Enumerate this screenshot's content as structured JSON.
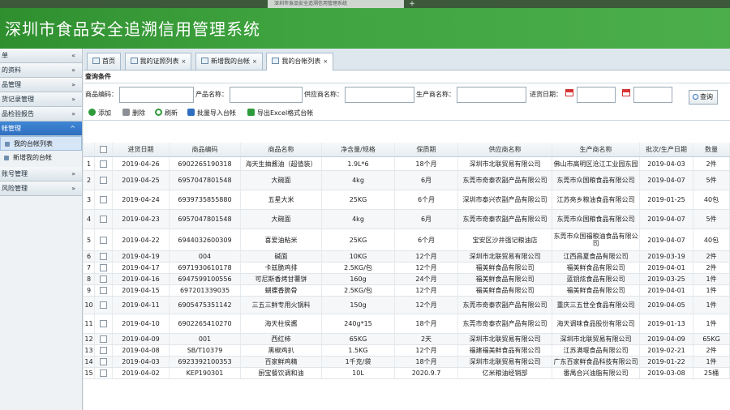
{
  "browser": {
    "tab_title": "深圳市食品安全追溯信用管理系统",
    "new_tab": "+"
  },
  "header": {
    "title": "深圳市食品安全追溯信用管理系统"
  },
  "sidebar": {
    "items": [
      {
        "label": "单",
        "chev": "«"
      },
      {
        "label": "的资料",
        "chev": "»"
      },
      {
        "label": "品管理",
        "chev": "»"
      },
      {
        "label": "货记录管理",
        "chev": "»"
      },
      {
        "label": "品检验报告",
        "chev": "»"
      },
      {
        "label": "帐管理",
        "chev": "^"
      }
    ],
    "sub": [
      {
        "label": "我的台帐列表"
      },
      {
        "label": "新增我的台帐"
      }
    ],
    "items2": [
      {
        "label": "账号管理",
        "chev": "»"
      },
      {
        "label": "风险管理",
        "chev": "»"
      }
    ]
  },
  "tabs": [
    {
      "label": "首页",
      "close": ""
    },
    {
      "label": "我的证照列表",
      "close": "×"
    },
    {
      "label": "新增我的台帐",
      "close": "×"
    },
    {
      "label": "我的台帐列表",
      "close": "×"
    }
  ],
  "query": {
    "title": "查询条件",
    "product_code": "商品编码：",
    "product_name": "产品名称：",
    "supplier": "供应商名称：",
    "producer": "生产商名称：",
    "date": "进货日期：",
    "search_btn": "查询"
  },
  "toolbar": {
    "add": "添加",
    "delete": "删除",
    "refresh": "刷新",
    "import": "批量导入台帐",
    "export": "导出Excel格式台帐"
  },
  "table": {
    "columns": [
      "进货日期",
      "商品编码",
      "商品名称",
      "净含量/规格",
      "保质期",
      "供应商名称",
      "生产商名称",
      "批次/生产日期",
      "数量"
    ],
    "rows": [
      [
        "2019-04-26",
        "6902265190318",
        "海天生抽酱油（超值装）",
        "1.9L*6",
        "18个月",
        "深圳市北联贸易有限公司",
        "佛山市高明区沧江工业园东园",
        "2019-04-03",
        "2件"
      ],
      [
        "2019-04-25",
        "6957047801548",
        "大碗面",
        "4kg",
        "6月",
        "东莞市奇泰农副产品有限公司",
        "东莞市众国粮食品有限公司",
        "2019-04-07",
        "5件"
      ],
      [
        "2019-04-24",
        "6939735855880",
        "五星大米",
        "25KG",
        "6个月",
        "深圳市泰兴农副产品有限公司",
        "江苏亮乡粮油食品有限公司",
        "2019-01-25",
        "40包"
      ],
      [
        "2019-04-23",
        "6957047801548",
        "大碗面",
        "4kg",
        "6月",
        "东莞市奇泰农副产品有限公司",
        "东莞市众国粮食品有限公司",
        "2019-04-07",
        "5件"
      ],
      [
        "2019-04-22",
        "6944032600309",
        "喜爱油粘米",
        "25KG",
        "6个月",
        "宝安区沙井强记粮油店",
        "东莞市众国福粮油食品有限公司",
        "2019-04-07",
        "40包"
      ],
      [
        "2019-04-19",
        "004",
        "碱面",
        "10KG",
        "12个月",
        "深圳市北联贸易有限公司",
        "江西昌夏食品有限公司",
        "2019-03-19",
        "2件"
      ],
      [
        "2019-04-17",
        "6971930610178",
        "卡兹脆鸡排",
        "2.5KG/包",
        "12个月",
        "福美鲜食品有限公司",
        "福美鲜食品有限公司",
        "2019-04-01",
        "2件"
      ],
      [
        "2019-04-16",
        "6947599100556",
        "可尼斯香烤甘薯饼",
        "160g",
        "24个月",
        "福美鲜食品有限公司",
        "蓝钥炫食品有限公司",
        "2019-03-25",
        "1件"
      ],
      [
        "2019-04-15",
        "697201339035",
        "蝴蝶香脆骨",
        "2.5KG/包",
        "12个月",
        "福美鲜食品有限公司",
        "福美鲜食品有限公司",
        "2019-04-01",
        "1件"
      ],
      [
        "2019-04-11",
        "6905475351142",
        "三五三鲜专用火锅料",
        "150g",
        "12个月",
        "东莞市奇泰农副产品有限公司",
        "重庆三五世全食品有限公司",
        "2019-04-05",
        "1件"
      ],
      [
        "2019-04-10",
        "6902265410270",
        "海天柱侯酱",
        "240g*15",
        "18个月",
        "东莞市奇泰农副产品有限公司",
        "海天调味食品股份有限公司",
        "2019-01-13",
        "1件"
      ],
      [
        "2019-04-09",
        "001",
        "西红柿",
        "65KG",
        "2天",
        "深圳市北联贸易有限公司",
        "深圳市北联贸易有限公司",
        "2019-04-09",
        "65KG"
      ],
      [
        "2019-04-08",
        "SB/T10379",
        "黑椒鸡扒",
        "1.5KG",
        "12个月",
        "福建福美鲜食品有限公司",
        "江苏满堰食品有限公司",
        "2019-02-21",
        "2件"
      ],
      [
        "2019-04-03",
        "6923392100353",
        "百家鲜鸡精",
        "1千克/袋",
        "18个月",
        "深圳市北联贸易有限公司",
        "广东百家鲜食品科技有限公司",
        "2019-01-22",
        "1件"
      ],
      [
        "2019-04-02",
        "KEP190301",
        "厨宝餐饮调和油",
        "10L",
        "2020.9.7",
        "亿米粮油经销部",
        "番禺合兴油脂有限公司",
        "2019-03-08",
        "25桶"
      ]
    ]
  }
}
